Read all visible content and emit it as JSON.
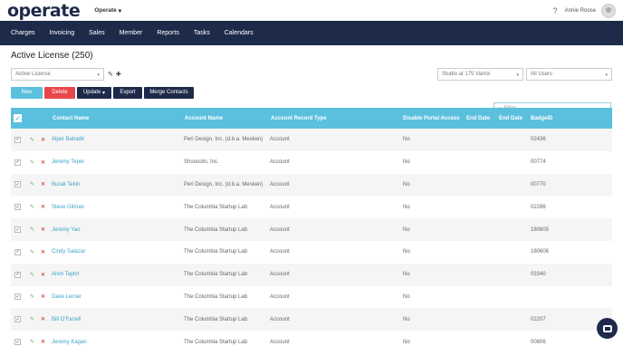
{
  "header": {
    "logo": "operate",
    "app_selector": "Operate",
    "help": "?",
    "user_name": "Annie Roose"
  },
  "nav": [
    "Charges",
    "Invoicing",
    "Sales",
    "Member",
    "Reports",
    "Tasks",
    "Calendars"
  ],
  "page": {
    "title": "Active License (250)",
    "view_select": "Active License",
    "location_select": "Studio at 175 Varick",
    "users_select": "All Users",
    "filter_placeholder": "Filter",
    "buttons": {
      "new": "New",
      "delete": "Delete",
      "update": "Update",
      "export": "Export",
      "merge": "Merge Contacts"
    }
  },
  "colors": {
    "nav_bg": "#1e2a4a",
    "header_bg": "#5bc0de",
    "new": "#5bc0de",
    "delete": "#e8474a",
    "dark_btn": "#1e2a4a"
  },
  "columns": [
    "Contact Name",
    "Account Name",
    "Account Record Type",
    "Disable Portal Access",
    "End Date",
    "End Date",
    "BadgeID"
  ],
  "rows": [
    {
      "contact": "Alper Bahadir",
      "account": "Peri Design, Inc. (d.b.a. Mesken)",
      "type": "Account",
      "portal": "No",
      "badge": "02436"
    },
    {
      "contact": "Jeremy Teper",
      "account": "Shooootn, Inc.",
      "type": "Account",
      "portal": "No",
      "badge": "00774"
    },
    {
      "contact": "Burak Tekin",
      "account": "Peri Design, Inc. (d.b.a. Mesken)",
      "type": "Account",
      "portal": "No",
      "badge": "00770"
    },
    {
      "contact": "Steve Gilman",
      "account": "The Columbia Startup Lab",
      "type": "Account",
      "portal": "No",
      "badge": "02286"
    },
    {
      "contact": "Jeremy Yao",
      "account": "The Columbia Startup Lab",
      "type": "Account",
      "portal": "No",
      "badge": "180605"
    },
    {
      "contact": "Cindy Salazar",
      "account": "The Columbia Startup Lab",
      "type": "Account",
      "portal": "No",
      "badge": "180606"
    },
    {
      "contact": "Alvin Taylor",
      "account": "The Columbia Startup Lab",
      "type": "Account",
      "portal": "No",
      "badge": "03340"
    },
    {
      "contact": "Dave Lerner",
      "account": "The Columbia Startup Lab",
      "type": "Account",
      "portal": "No",
      "badge": ""
    },
    {
      "contact": "Bill O'Farrell",
      "account": "The Columbia Startup Lab",
      "type": "Account",
      "portal": "No",
      "badge": "02207"
    },
    {
      "contact": "Jeremy Kagan",
      "account": "The Columbia Startup Lab",
      "type": "Account",
      "portal": "No",
      "badge": "00806"
    }
  ]
}
